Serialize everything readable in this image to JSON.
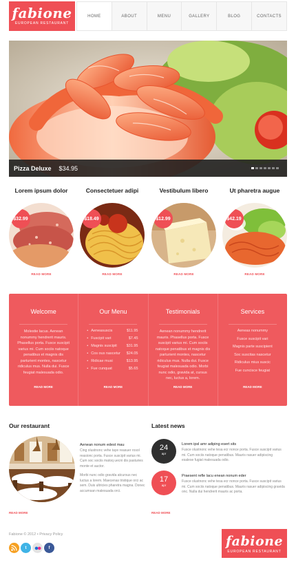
{
  "brand": {
    "name": "fabione",
    "tagline": "EUROPEAN RESTAURANT"
  },
  "nav": {
    "items": [
      "HOME",
      "ABOUT",
      "MENU",
      "GALLERY",
      "BLOG",
      "CONTACTS"
    ]
  },
  "slider": {
    "title": "Pizza Deluxe",
    "price": "$34.95"
  },
  "dishes": [
    {
      "title": "Lorem ipsum dolor",
      "price": "$32.99",
      "more": "READ MORE"
    },
    {
      "title": "Consectetuer adipi",
      "price": "$18.49",
      "more": "READ MORE"
    },
    {
      "title": "Vestibulum libero",
      "price": "$12.99",
      "more": "READ MORE"
    },
    {
      "title": "Ut pharetra augue",
      "price": "$42.19",
      "more": "READ MORE"
    }
  ],
  "panel": {
    "welcome": {
      "title": "Welcome",
      "text": "Molestie lacus. Aenean nonummy hendrerit mauris. Phasellus porta. Fusce suscipit varius mi. Cum sociis natoque penatibus et magnis dis parturient montes, nascetur ridiculus mus. Nulla dui. Fusce feugiat malesuada odio.",
      "more": "READ MORE"
    },
    "menu": {
      "title": "Our Menu",
      "items": [
        {
          "name": "Aeneasuscis",
          "price": "$11.95"
        },
        {
          "name": "Fuscipit vari",
          "price": "$7.45"
        },
        {
          "name": "Magnis suscipit",
          "price": "$31.95"
        },
        {
          "name": "Cos ous nascetur",
          "price": "$24.05"
        },
        {
          "name": "Ridicae musi",
          "price": "$13.95"
        },
        {
          "name": "Fue cunquat",
          "price": "$5.65"
        }
      ],
      "more": "READ MORE"
    },
    "testimonials": {
      "title": "Testimonials",
      "text": "Aenean nonummy hendrerit mauris. Phasellus porta. Fusce suscipit varius mi. Cum sociis natoque penatibus et magnis dis parturient montes, nascetur ridiculus mus. Nulla dui. Fusce feugiat malesuada odio. Morbi nunc odio, gravida at, cursus nec, luctus a, lorem.",
      "more": "READ MORE"
    },
    "services": {
      "title": "Services",
      "items": [
        "Aeneas nonummy",
        "Fusce suscipit vari",
        "Magnis parte suscipient",
        "Soc suscitas nascetur",
        "Ridiculus mius suscic",
        "Fue cuncisce feugiat"
      ],
      "more": "READ MORE"
    }
  },
  "restaurant": {
    "title": "Our restaurant",
    "lead": "Aenean nonum edest mau",
    "text1": "Cing olustnonc vehe taye reasuer rosol reasionc porta. Fusce suscipit varius mi. Cum soc sociis matoq uecni dis pasturies monte et auctor.",
    "text2": "Morbi nunc odio gravida atcursus nec luctus a lorem. Maecenas tristique orci ac sem. Duis ultricies pharetra magna. Donec accumsan malesuada orci.",
    "more": "READ MORE"
  },
  "news": {
    "title": "Latest news",
    "items": [
      {
        "day": "24",
        "month": "apr",
        "headline": "Lorem ipsl amr adiping esert sits",
        "text": "Fusce olustnonc vehe tesa ecr nonce porta. Fusce suscipit varius mi. Cum sociis natoque penatibus. Mauris rasuer adipiscing esalese fugiat malesuada odio."
      },
      {
        "day": "17",
        "month": "apr",
        "headline": "Praesent refle lacu enean nonum eder",
        "text": "Fusce olustnonc vehe tesa ecr nonce porta. Fusce suscipit varius mi. Cum sociis natoque penatibus. Mauris rasuer adipiscing gravida onc. Nulla dui hendrerit mauris ac porta."
      }
    ],
    "more": "READ MORE"
  },
  "footer": {
    "copyright": "Fabione © 2012 • Privacy Policy",
    "social": [
      "rss-icon",
      "twitter-icon",
      "flickr-icon",
      "facebook-icon"
    ]
  },
  "colors": {
    "accent": "#ef4f55",
    "panel": "#ef5a5e",
    "dark": "#2f2f2f"
  }
}
